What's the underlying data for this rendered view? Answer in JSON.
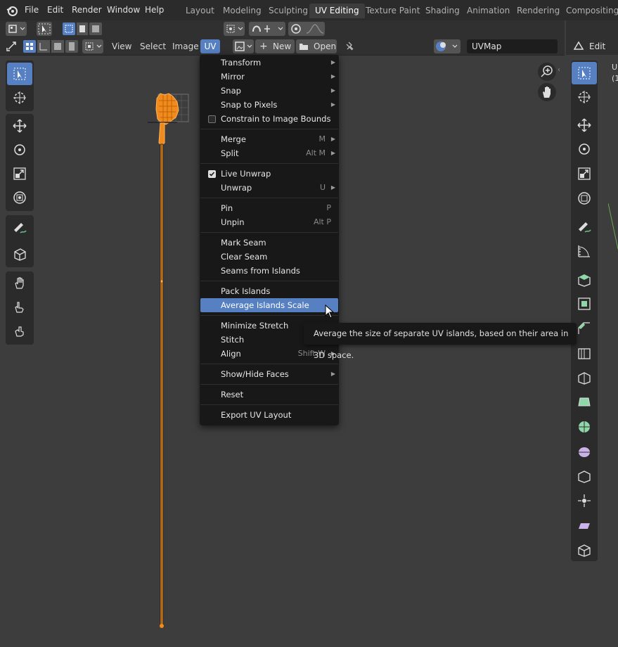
{
  "menubar": {
    "items": [
      "File",
      "Edit",
      "Render",
      "Window",
      "Help"
    ]
  },
  "workspaces": {
    "tabs": [
      "Layout",
      "Modeling",
      "Sculpting",
      "UV Editing",
      "Texture Paint",
      "Shading",
      "Animation",
      "Rendering",
      "Compositing"
    ],
    "active_index": 3
  },
  "uv_header": {
    "menus": [
      "View",
      "Select",
      "Image",
      "UV"
    ],
    "new_label": "New",
    "open_label": "Open",
    "uvmap_value": "UVMap"
  },
  "right_panel": {
    "mode_label": "Edit Mod",
    "text_u": "U",
    "text_paren": "(1"
  },
  "uv_menu": {
    "items": [
      {
        "label": "Transform",
        "shortcut": "",
        "submenu": true
      },
      {
        "label": "Mirror",
        "shortcut": "",
        "submenu": true
      },
      {
        "label": "Snap",
        "shortcut": "",
        "submenu": true
      },
      {
        "label": "Snap to Pixels",
        "shortcut": "",
        "submenu": true
      },
      {
        "label": "Constrain to Image Bounds",
        "checkbox": false
      },
      {
        "label": "Merge",
        "shortcut": "M",
        "submenu": true
      },
      {
        "label": "Split",
        "shortcut": "Alt M",
        "submenu": true
      },
      {
        "label": "Live Unwrap",
        "checkbox": true
      },
      {
        "label": "Unwrap",
        "shortcut": "U",
        "submenu": true
      },
      {
        "label": "Pin",
        "shortcut": "P"
      },
      {
        "label": "Unpin",
        "shortcut": "Alt P"
      },
      {
        "label": "Mark Seam",
        "shortcut": ""
      },
      {
        "label": "Clear Seam",
        "shortcut": ""
      },
      {
        "label": "Seams from Islands",
        "shortcut": ""
      },
      {
        "label": "Pack Islands",
        "shortcut": ""
      },
      {
        "label": "Average Islands Scale",
        "shortcut": "",
        "highlighted": true
      },
      {
        "label": "Minimize Stretch",
        "shortcut": ""
      },
      {
        "label": "Stitch",
        "shortcut": ""
      },
      {
        "label": "Align",
        "shortcut": "Shift W",
        "submenu": true
      },
      {
        "label": "Show/Hide Faces",
        "shortcut": "",
        "submenu": true
      },
      {
        "label": "Reset",
        "shortcut": ""
      },
      {
        "label": "Export UV Layout",
        "shortcut": ""
      }
    ]
  },
  "tooltip": {
    "text": "Average the size of separate UV islands, based on their area in 3D space."
  },
  "colors": {
    "accent": "#5680c2",
    "uv_orange": "#f08a1c",
    "menu_bg": "#181818"
  }
}
